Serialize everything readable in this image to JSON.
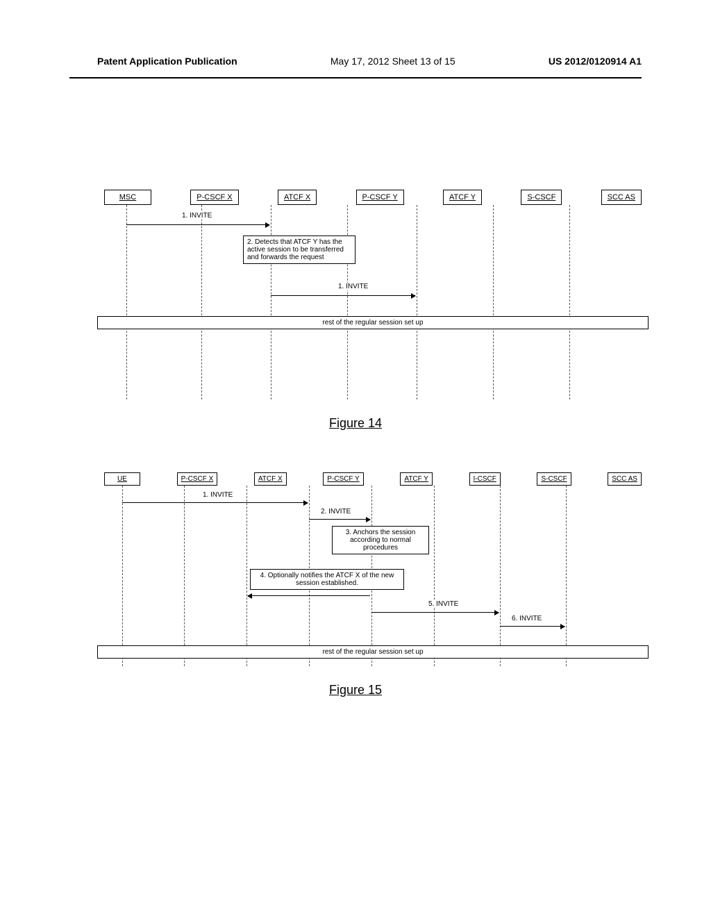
{
  "header": {
    "left": "Patent Application Publication",
    "center": "May 17, 2012  Sheet 13 of 15",
    "right": "US 2012/0120914 A1"
  },
  "figure14": {
    "caption": "Figure 14",
    "entities": [
      "MSC",
      "P-CSCF X",
      "ATCF X",
      "P-CSCF Y",
      "ATCF Y",
      "S-CSCF",
      "SCC AS"
    ],
    "msg1": "1. INVITE",
    "note2": "2. Detects that ATCF Y has the active session to be transferred and forwards the request",
    "msg3": "1. INVITE",
    "spanbox": "rest of the regular session set up"
  },
  "figure15": {
    "caption": "Figure 15",
    "entities": [
      "UE",
      "P-CSCF X",
      "ATCF X",
      "P-CSCF Y",
      "ATCF Y",
      "I-CSCF",
      "S-CSCF",
      "SCC AS"
    ],
    "msg1": "1. INVITE",
    "msg2": "2. INVITE",
    "note3": "3. Anchors the session according to normal procedures",
    "note4": "4. Optionally notifies the ATCF X of the new session established.",
    "msg5": "5. INVITE",
    "msg6": "6. INVITE",
    "spanbox": "rest of the regular session set up"
  }
}
